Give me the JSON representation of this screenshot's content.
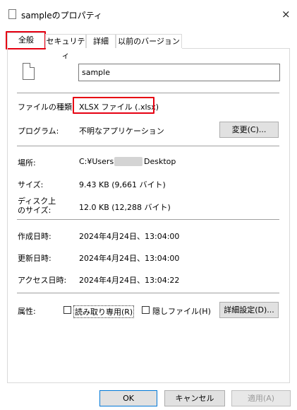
{
  "window": {
    "title": "sampleのプロパティ",
    "close": "×"
  },
  "tabs": [
    {
      "label": "全般"
    },
    {
      "label": "セキュリティ"
    },
    {
      "label": "詳細"
    },
    {
      "label": "以前のバージョン"
    }
  ],
  "general": {
    "file_name": "sample",
    "file_type_label": "ファイルの種類:",
    "file_type_value": "XLSX ファイル (.xlsx)",
    "program_label": "プログラム:",
    "program_value": "不明なアプリケーション",
    "change_button": "変更(C)...",
    "location_label": "場所:",
    "location_prefix": "C:¥Users",
    "location_suffix": "Desktop",
    "size_label": "サイズ:",
    "size_value": "9.43 KB (9,661 バイト)",
    "disk_size_label_line1": "ディスク上",
    "disk_size_label_line2": "のサイズ:",
    "disk_size_value": "12.0 KB (12,288 バイト)",
    "created_label": "作成日時:",
    "created_value": "2024年4月24日、13:04:00",
    "modified_label": "更新日時:",
    "modified_value": "2024年4月24日、13:04:00",
    "accessed_label": "アクセス日時:",
    "accessed_value": "2024年4月24日、13:04:22",
    "attributes_label": "属性:",
    "readonly_label": "読み取り専用(R)",
    "hidden_label": "隠しファイル(H)",
    "advanced_button": "詳細設定(D)..."
  },
  "footer": {
    "ok": "OK",
    "cancel": "キャンセル",
    "apply": "適用(A)"
  },
  "colors": {
    "highlight": "#e60012",
    "primary_border": "#0078d7"
  }
}
